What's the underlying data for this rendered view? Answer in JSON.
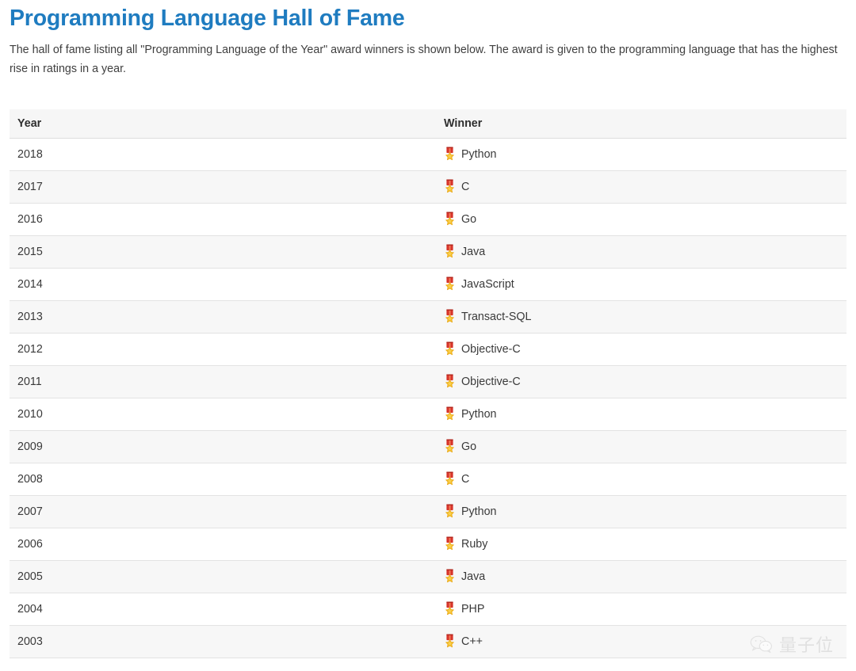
{
  "page": {
    "title": "Programming Language Hall of Fame",
    "description": "The hall of fame listing all \"Programming Language of the Year\" award winners is shown below. The award is given to the programming language that has the highest rise in ratings in a year.",
    "title_color": "#1f7cc0",
    "text_color": "#3f3f3f"
  },
  "table": {
    "columns": [
      {
        "key": "year",
        "label": "Year"
      },
      {
        "key": "winner",
        "label": "Winner"
      }
    ],
    "header_background": "#f6f6f6",
    "stripe_color": "#f7f7f7",
    "border_color": "#e3e3e3",
    "winner_icon": "medal-icon",
    "rows": [
      {
        "year": "2018",
        "winner": "Python"
      },
      {
        "year": "2017",
        "winner": "C"
      },
      {
        "year": "2016",
        "winner": "Go"
      },
      {
        "year": "2015",
        "winner": "Java"
      },
      {
        "year": "2014",
        "winner": "JavaScript"
      },
      {
        "year": "2013",
        "winner": "Transact-SQL"
      },
      {
        "year": "2012",
        "winner": "Objective-C"
      },
      {
        "year": "2011",
        "winner": "Objective-C"
      },
      {
        "year": "2010",
        "winner": "Python"
      },
      {
        "year": "2009",
        "winner": "Go"
      },
      {
        "year": "2008",
        "winner": "C"
      },
      {
        "year": "2007",
        "winner": "Python"
      },
      {
        "year": "2006",
        "winner": "Ruby"
      },
      {
        "year": "2005",
        "winner": "Java"
      },
      {
        "year": "2004",
        "winner": "PHP"
      },
      {
        "year": "2003",
        "winner": "C++"
      }
    ]
  },
  "watermark": {
    "text": "量子位",
    "logo": "wechat-logo-icon",
    "color": "#cccccc"
  }
}
